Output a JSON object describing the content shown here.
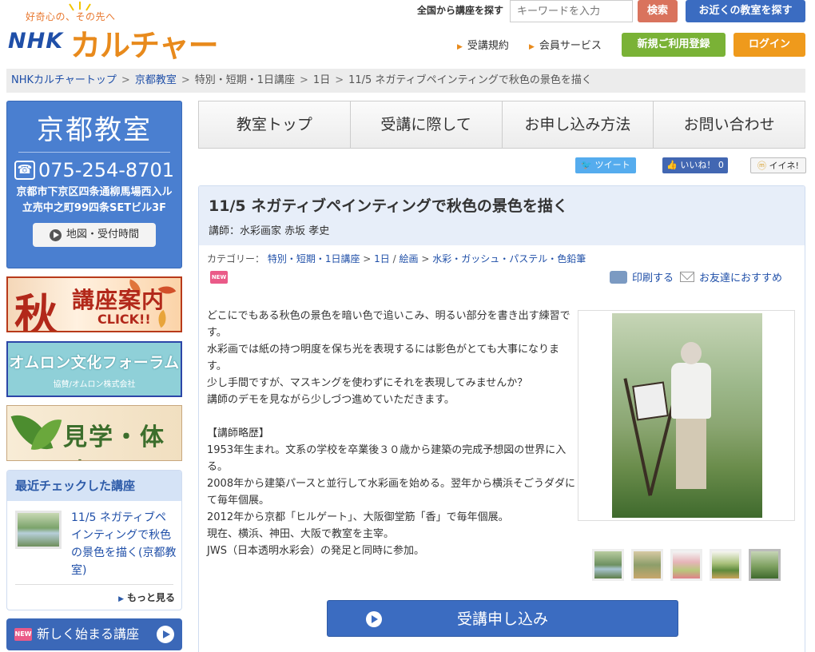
{
  "header": {
    "tagline": "好奇心の、その先へ",
    "logo_nhk": "NHK",
    "logo_culture": "カルチャー",
    "search_label": "全国から講座を探す",
    "search_placeholder": "キーワードを入力",
    "search_button": "検索",
    "near_button": "お近くの教室を探す",
    "link_terms": "受講規約",
    "link_member": "会員サービス",
    "register_button": "新規ご利用登録",
    "login_button": "ログイン"
  },
  "breadcrumb": {
    "items": [
      "NHKカルチャートップ",
      "京都教室",
      "特別・短期・1日講座",
      "1日",
      "11/5 ネガティブペインティングで秋色の景色を描く"
    ],
    "sep": ">"
  },
  "sidebar": {
    "school_name": "京都教室",
    "phone": "075-254-8701",
    "phone_icon": "☎",
    "address": "京都市下京区四条通柳馬場西入ル 立売中之町99四条SETビル3F",
    "map_button": "地図・受付時間",
    "banner_aki_big": "秋",
    "banner_aki_title": "講座案内",
    "banner_aki_click": "CLICK!!",
    "banner_omron_title": "オムロン文化フォーラム",
    "banner_omron_sub": "協賛/オムロン株式会社",
    "banner_kengaku": "見学・体験",
    "recent_heading": "最近チェックした講座",
    "recent_title": "11/5 ネガティブペインティングで秋色の景色を描く(京都教室)",
    "recent_more": "もっと見る",
    "new_icon": "NEW",
    "new_courses": "新しく始まる講座"
  },
  "nav": {
    "tabs": [
      "教室トップ",
      "受講に際して",
      "お申し込み方法",
      "お問い合わせ"
    ]
  },
  "social": {
    "tweet": "ツイート",
    "like": "いいね！ 0",
    "mixi": "イイネ!"
  },
  "course": {
    "title": "11/5 ネガティブペインティングで秋色の景色を描く",
    "teacher": "講師：水彩画家 赤坂 孝史",
    "category_label": "カテゴリー：",
    "categories": [
      "特別・短期・1日講座",
      "1日",
      "絵画",
      "水彩・ガッシュ・パステル・色鉛筆"
    ],
    "new_tag": "NEW",
    "print": "印刷する",
    "recommend": "お友達におすすめ",
    "desc": [
      "どこにでもある秋色の景色を暗い色で追いこみ、明るい部分を書き出す練習です。",
      "水彩画では紙の持つ明度を保ち光を表現するには影色がとても大事になります。",
      "少し手間ですが、マスキングを使わずにそれを表現してみませんか？",
      "講師のデモを見ながら少しづつ進めていただきます。",
      "",
      "【講師略歴】",
      "1953年生まれ。文系の学校を卒業後３０歳から建築の完成予想図の世界に入る。",
      "2008年から建築パースと並行して水彩画を始める。翌年から横浜そごうダダにて毎年個展。",
      "2012年から京都「ヒルゲート」、大阪御堂筋「香」で毎年個展。",
      "現在、横浜、神田、大阪で教室を主宰。",
      "JWS（日本透明水彩会）の発足と同時に参加。"
    ],
    "apply_button": "受講申し込み"
  },
  "colors": {
    "brand_blue": "#3b6cc1",
    "brand_orange": "#e88a1c",
    "register_green": "#7ab236",
    "login_orange": "#ef9a1c",
    "search_red": "#d9735d"
  }
}
